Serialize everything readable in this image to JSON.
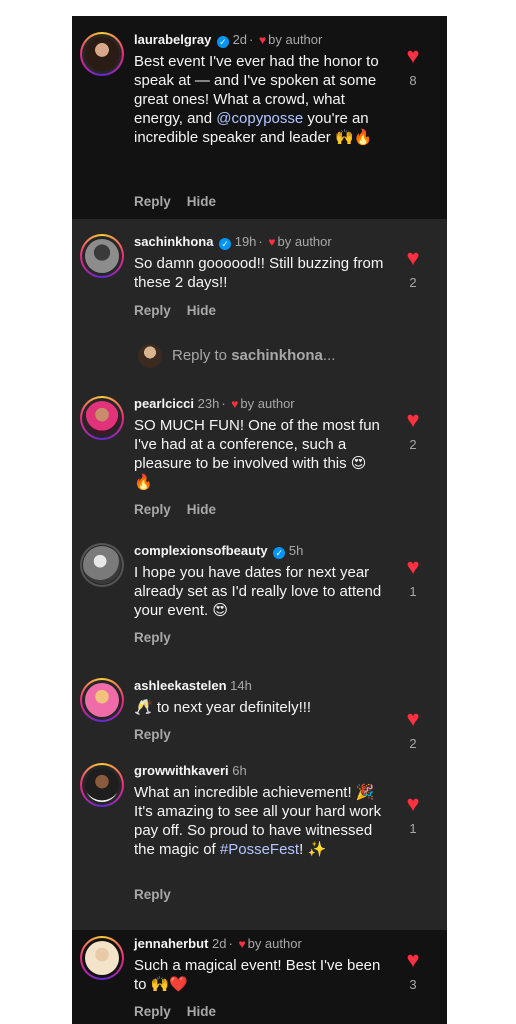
{
  "comments": [
    {
      "username": "laurabelgray",
      "verified": true,
      "time": "2d",
      "by_author": "by author",
      "text_parts": [
        "Best event I've ever had the honor to speak at — and I've spoken at some great ones! What a crowd, what energy, and ",
        "@copyposse",
        " you're an incredible speaker and leader 🙌🔥"
      ],
      "actions": [
        "Reply",
        "Hide"
      ],
      "likes": "8"
    },
    {
      "username": "sachinkhona",
      "verified": true,
      "time": "19h",
      "by_author": "by author",
      "text": "So damn goooood!! Still buzzing from these 2 days!!",
      "actions": [
        "Reply",
        "Hide"
      ],
      "likes": "2"
    },
    {
      "username": "pearlcicci",
      "verified": false,
      "time": "23h",
      "by_author": "by author",
      "text": "SO MUCH FUN! One of the most fun I've had at a conference, such a pleasure to be involved with this 😍 🔥",
      "actions": [
        "Reply",
        "Hide"
      ],
      "likes": "2"
    },
    {
      "username": "complexionsofbeauty",
      "verified": true,
      "time": "5h",
      "text": "I hope you have dates for next year already set as I'd really love to attend your event. 😍",
      "actions": [
        "Reply"
      ],
      "likes": "1"
    },
    {
      "username": "ashleekastelen",
      "verified": false,
      "time": "14h",
      "text": "🥂  to next year definitely!!!",
      "actions": [
        "Reply"
      ],
      "likes": "2"
    },
    {
      "username": "growwithkaveri",
      "verified": false,
      "time": "6h",
      "text_parts": [
        "What an incredible achievement! 🎉 It's amazing to see all your hard work pay off. So proud to have witnessed the magic of ",
        "#PosseFest",
        "! ✨"
      ],
      "actions": [
        "Reply"
      ],
      "likes": "1"
    },
    {
      "username": "jennaherbut",
      "verified": false,
      "time": "2d",
      "by_author": "by author",
      "text": "Such a magical event! Best I've been to 🙌❤️",
      "actions": [
        "Reply",
        "Hide"
      ],
      "likes": "3"
    }
  ],
  "reply_prompt": {
    "prefix": "Reply to ",
    "username": "sachinkhona",
    "suffix": "..."
  },
  "icons": {
    "like": "heart-icon",
    "verified": "verified-badge-icon",
    "author_like": "small-heart-icon"
  },
  "colors": {
    "heart": "#ff3040",
    "verified": "#0095f6",
    "link": "#b3c7ff",
    "background": "#262626",
    "highlight": "#121212"
  }
}
